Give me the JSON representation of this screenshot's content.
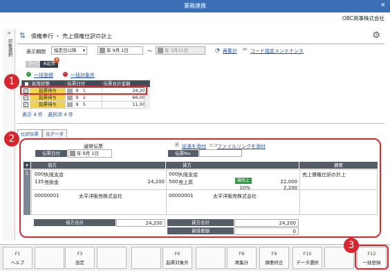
{
  "window": {
    "title": "業務連携",
    "close": "✕",
    "company": "OBC商事株式会社"
  },
  "sidebar": {
    "label": "対象選択",
    "arrow": ">"
  },
  "page": {
    "breadcrumb": "債権奉行 ・ 売上債権仕訳の計上"
  },
  "filter": {
    "period_label": "表示期間",
    "period_value": "指定日以降",
    "date_from": "年  9月  1日",
    "date_sep": "～",
    "date_to": "年  3月31日",
    "recalc": "再集計",
    "code_settings": "コード設定メンテナンス"
  },
  "status_tabs": {
    "all": "すべて",
    "unposted": "未起票",
    "unposted_count": "4"
  },
  "bulk": {
    "apply": "一括登録",
    "exclude": "一括対象外"
  },
  "list": {
    "headers": [
      "処理状態",
      "伝票日付",
      "伝票合計金額"
    ],
    "rows": [
      {
        "status": "起票待ち",
        "month": "9",
        "day": "1",
        "amount": "24,200"
      },
      {
        "status": "起票待ち",
        "month": "9",
        "day": "1",
        "amount": "66,000"
      },
      {
        "status": "起票待ち",
        "month": "9",
        "day": "5",
        "amount": "11,000"
      }
    ],
    "summary": "表示 4 件　選択済 4 件"
  },
  "tabs": [
    "仕訳伝票",
    "元データ"
  ],
  "voucher": {
    "type_label": "通常伝票",
    "date_label": "伝票日付",
    "date_value": "年  9月  1日",
    "attach_voucher": "証憑を添付",
    "attach_file": "ファイルリンクを添付",
    "no_label": "伝票No.",
    "col_debit": "借方",
    "col_credit": "貸方",
    "col_memo": "摘要",
    "line_no": "1",
    "debit_dept_code": "000(",
    "debit_dept": "大阪支店",
    "debit_acct_code": "135",
    "debit_acct": "売掛金",
    "debit_amount": "24,200",
    "credit_dept_code": "000(",
    "credit_dept": "大阪支店",
    "credit_acct_code": "500",
    "credit_acct": "売上高",
    "tax_tag": "課売上",
    "credit_amount": "22,000",
    "tax_rate": "10%",
    "tax_amount": "2,200",
    "memo": "売上債権仕訳の計上",
    "debit_client_code": "00000001",
    "debit_client": "太平洋販売株式会社",
    "credit_client_code": "00000001",
    "credit_client": "太平洋販売株式会社",
    "debit_total_label": "借方合計",
    "debit_total": "24,200",
    "credit_total_label": "貸方合計",
    "credit_total": "24,200",
    "diff_label": "貸借差額",
    "diff": "0"
  },
  "fkeys": [
    {
      "key": "F1",
      "label": "ヘルプ"
    },
    {
      "key": "",
      "label": ""
    },
    {
      "key": "F3",
      "label": "設定"
    },
    {
      "key": "",
      "label": ""
    },
    {
      "key": "",
      "label": ""
    },
    {
      "key": "F6",
      "label": "起票対象外"
    },
    {
      "key": "",
      "label": ""
    },
    {
      "key": "F8",
      "label": "再集計"
    },
    {
      "key": "F9",
      "label": "摘要修正"
    },
    {
      "key": "F10",
      "label": "データ選択"
    },
    {
      "key": "",
      "label": ""
    },
    {
      "key": "F12",
      "label": "一括登録"
    }
  ],
  "callouts": [
    "1",
    "2",
    "3"
  ],
  "colors": {
    "titlebar": "#3a6fb5",
    "callout": "#d6262e",
    "status_wait": "#f1d44c",
    "tag_green": "#2e9a3f"
  }
}
